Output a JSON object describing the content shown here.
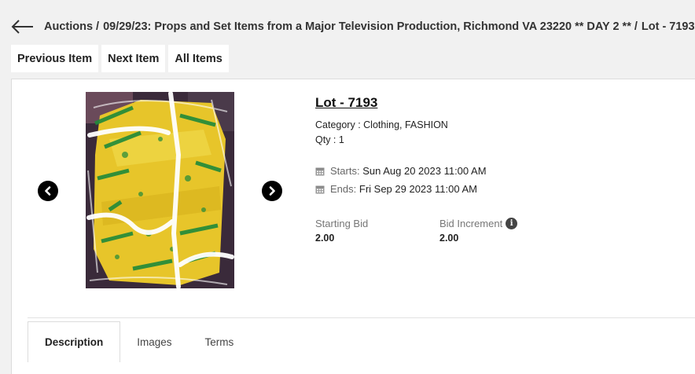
{
  "breadcrumb": {
    "items": [
      "Auctions",
      "09/29/23: Props and Set Items from a Major Television Production, Richmond VA 23220 ** DAY 2 **",
      "Lot - 7193"
    ],
    "separator": "/"
  },
  "nav": {
    "previous": "Previous Item",
    "next": "Next Item",
    "all": "All Items"
  },
  "lot": {
    "title": "Lot - 7193",
    "category_label": "Category :",
    "category_value": "Clothing, FASHION",
    "qty_label": "Qty :",
    "qty_value": "1",
    "starts_label": "Starts:",
    "starts_value": "Sun Aug 20 2023 11:00 AM",
    "ends_label": "Ends:",
    "ends_value": "Fri Sep 29 2023 11:00 AM",
    "starting_bid_label": "Starting Bid",
    "starting_bid_value": "2.00",
    "bid_increment_label": "Bid Increment",
    "bid_increment_value": "2.00"
  },
  "tabs": [
    {
      "label": "Description",
      "active": true
    },
    {
      "label": "Images",
      "active": false
    },
    {
      "label": "Terms",
      "active": false
    }
  ],
  "icons": {
    "back": "arrow-left-icon",
    "prev": "chevron-left-icon",
    "next": "chevron-right-icon",
    "calendar": "calendar-icon",
    "info": "info-icon"
  },
  "colors": {
    "background": "#f1f1f1",
    "card": "#ffffff",
    "photo_yellow": "#e7c52a",
    "photo_green": "#1f8a3a"
  }
}
